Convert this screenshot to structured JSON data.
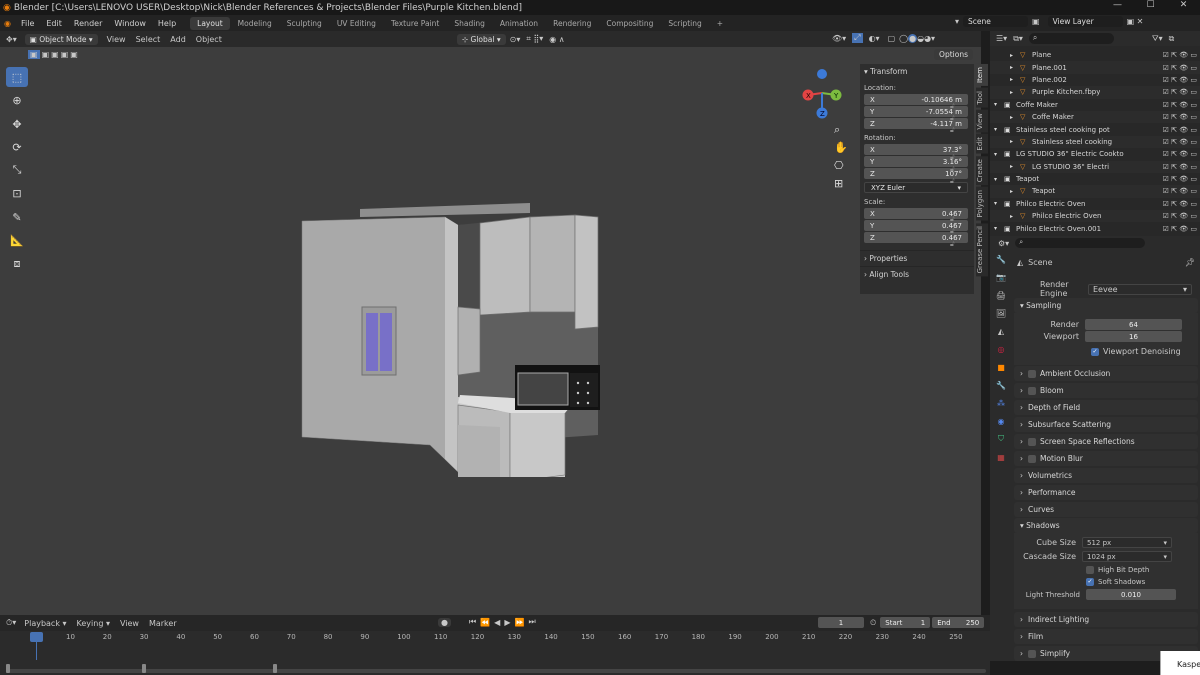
{
  "window": {
    "title": "Blender [C:\\Users\\LENOVO USER\\Desktop\\Nick\\Blender References & Projects\\Blender Files\\Purple Kitchen.blend]",
    "controls": [
      "—",
      "☐",
      "✕"
    ]
  },
  "menu": {
    "items": [
      "File",
      "Edit",
      "Render",
      "Window",
      "Help"
    ],
    "workspaces": [
      "Layout",
      "Modeling",
      "Sculpting",
      "UV Editing",
      "Texture Paint",
      "Shading",
      "Animation",
      "Rendering",
      "Compositing",
      "Scripting"
    ],
    "add": "+",
    "scene": "Scene",
    "view_layer": "View Layer"
  },
  "viewport_header": {
    "mode": "Object Mode",
    "menus": [
      "View",
      "Select",
      "Add",
      "Object"
    ],
    "orientation": "Global",
    "options": "Options"
  },
  "gizmo": {
    "x": "X",
    "y": "Y",
    "z": "Z"
  },
  "sidebar": {
    "transform": "Transform",
    "location_label": "Location:",
    "location": [
      {
        "axis": "X",
        "value": "-0.10646 m"
      },
      {
        "axis": "Y",
        "value": "-7.0554 m"
      },
      {
        "axis": "Z",
        "value": "-4.117 m"
      }
    ],
    "rotation_label": "Rotation:",
    "rotation": [
      {
        "axis": "X",
        "value": "37.3°"
      },
      {
        "axis": "Y",
        "value": "3.16°"
      },
      {
        "axis": "Z",
        "value": "107°"
      }
    ],
    "euler": "XYZ Euler",
    "scale_label": "Scale:",
    "scale": [
      {
        "axis": "X",
        "value": "0.467"
      },
      {
        "axis": "Y",
        "value": "0.467"
      },
      {
        "axis": "Z",
        "value": "0.467"
      }
    ],
    "properties": "Properties",
    "align_tools": "Align Tools",
    "tabs": [
      "Item",
      "Tool",
      "View",
      "Edit",
      "Create",
      "Polygon",
      "Grease Pencil"
    ]
  },
  "outliner": {
    "rows": [
      {
        "label": "Plane",
        "depth": 1
      },
      {
        "label": "Plane.001",
        "depth": 1
      },
      {
        "label": "Plane.002",
        "depth": 1
      },
      {
        "label": "Purple Kitchen.fbpy",
        "depth": 1
      },
      {
        "label": "Coffe Maker",
        "depth": 0
      },
      {
        "label": "Coffe Maker",
        "depth": 1
      },
      {
        "label": "Stainless steel cooking pot",
        "depth": 0
      },
      {
        "label": "Stainless steel cooking",
        "depth": 1
      },
      {
        "label": "LG STUDIO 36\" Electric Cookto",
        "depth": 0
      },
      {
        "label": "LG STUDIO 36\" Electri",
        "depth": 1
      },
      {
        "label": "Teapot",
        "depth": 0
      },
      {
        "label": "Teapot",
        "depth": 1
      },
      {
        "label": "Philco Electric Oven",
        "depth": 0
      },
      {
        "label": "Philco Electric Oven",
        "depth": 1
      },
      {
        "label": "Philco Electric Oven.001",
        "depth": 0
      }
    ]
  },
  "properties": {
    "scene": "Scene",
    "render_engine_label": "Render Engine",
    "render_engine": "Eevee",
    "sampling": "Sampling",
    "render_label": "Render",
    "render_value": "64",
    "viewport_label": "Viewport",
    "viewport_value": "16",
    "viewport_denoising": "Viewport Denoising",
    "panels": [
      "Ambient Occlusion",
      "Bloom",
      "Depth of Field",
      "Subsurface Scattering",
      "Screen Space Reflections",
      "Motion Blur",
      "Volumetrics",
      "Performance",
      "Curves"
    ],
    "shadows": "Shadows",
    "cube_size_label": "Cube Size",
    "cube_size": "512 px",
    "cascade_size_label": "Cascade Size",
    "cascade_size": "1024 px",
    "high_bit_depth": "High Bit Depth",
    "soft_shadows": "Soft Shadows",
    "light_threshold_label": "Light Threshold",
    "light_threshold": "0.010",
    "after": [
      "Indirect Lighting",
      "Film",
      "Simplify"
    ]
  },
  "timeline": {
    "menus": [
      "Playback",
      "Keying",
      "View",
      "Marker"
    ],
    "current_frame": "1",
    "start_label": "Start",
    "start": "1",
    "end_label": "End",
    "end": "250",
    "ticks": [
      "1",
      "10",
      "20",
      "30",
      "40",
      "50",
      "60",
      "70",
      "80",
      "90",
      "100",
      "110",
      "120",
      "130",
      "140",
      "150",
      "160",
      "170",
      "180",
      "190",
      "200",
      "210",
      "220",
      "230",
      "240",
      "250"
    ]
  },
  "notification": "Kaspe",
  "colors": {
    "accent": "#4772b3",
    "bg": "#3d3d3d"
  }
}
